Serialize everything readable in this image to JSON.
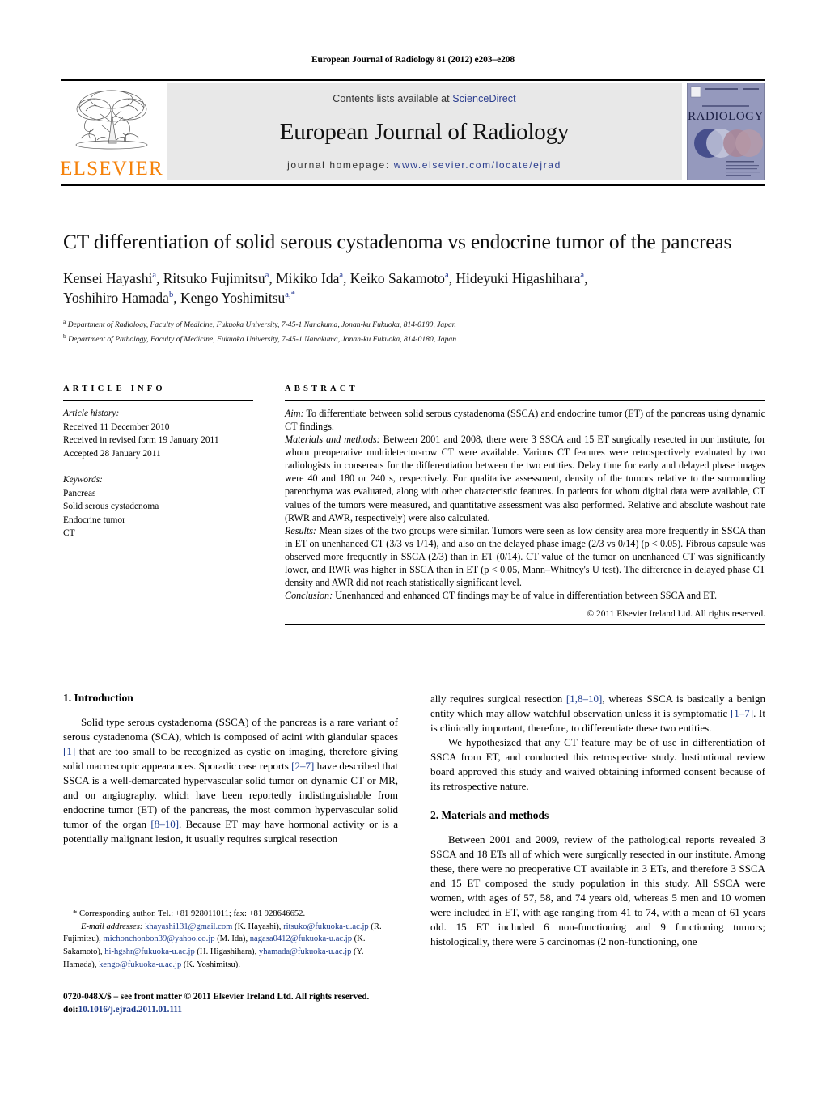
{
  "running_head": "European Journal of Radiology 81 (2012) e203–e208",
  "masthead": {
    "contents_prefix": "Contents lists available at ",
    "contents_link": "ScienceDirect",
    "journal_name": "European Journal of Radiology",
    "homepage_prefix": "journal homepage: ",
    "homepage_url": "www.elsevier.com/locate/ejrad",
    "publisher_logo_text": "ELSEVIER",
    "cover_title": "RADIOLOGY",
    "cover_supertitle": "EUROPEAN JOURNAL OF"
  },
  "article": {
    "title": "CT differentiation of solid serous cystadenoma vs endocrine tumor of the pancreas",
    "authors_line1": "Kensei Hayashi a, Ritsuko Fujimitsu a, Mikiko Ida a, Keiko Sakamoto a, Hideyuki Higashihara a,",
    "authors_line2": "Yoshihiro Hamada b, Kengo Yoshimitsu a,*",
    "affiliation_a": "Department of Radiology, Faculty of Medicine, Fukuoka University, 7-45-1 Nanakuma, Jonan-ku Fukuoka, 814-0180, Japan",
    "affiliation_b": "Department of Pathology, Faculty of Medicine, Fukuoka University, 7-45-1 Nanakuma, Jonan-ku Fukuoka, 814-0180, Japan"
  },
  "article_info": {
    "heading": "ARTICLE INFO",
    "history_label": "Article history:",
    "history": [
      "Received 11 December 2010",
      "Received in revised form 19 January 2011",
      "Accepted 28 January 2011"
    ],
    "keywords_label": "Keywords:",
    "keywords": [
      "Pancreas",
      "Solid serous cystadenoma",
      "Endocrine tumor",
      "CT"
    ]
  },
  "abstract": {
    "heading": "ABSTRACT",
    "aim_label": "Aim:",
    "aim_text": " To differentiate between solid serous cystadenoma (SSCA) and endocrine tumor (ET) of the pancreas using dynamic CT findings.",
    "methods_label": "Materials and methods:",
    "methods_text": " Between 2001 and 2008, there were 3 SSCA and 15 ET surgically resected in our institute, for whom preoperative multidetector-row CT were available. Various CT features were retrospectively evaluated by two radiologists in consensus for the differentiation between the two entities. Delay time for early and delayed phase images were 40 and 180 or 240 s, respectively. For qualitative assessment, density of the tumors relative to the surrounding parenchyma was evaluated, along with other characteristic features. In patients for whom digital data were available, CT values of the tumors were measured, and quantitative assessment was also performed. Relative and absolute washout rate (RWR and AWR, respectively) were also calculated.",
    "results_label": "Results:",
    "results_text": " Mean sizes of the two groups were similar. Tumors were seen as low density area more frequently in SSCA than in ET on unenhanced CT (3/3 vs 1/14), and also on the delayed phase image (2/3 vs 0/14) (p < 0.05). Fibrous capsule was observed more frequently in SSCA (2/3) than in ET (0/14). CT value of the tumor on unenhanced CT was significantly lower, and RWR was higher in SSCA than in ET (p < 0.05, Mann–Whitney's U test). The difference in delayed phase CT density and AWR did not reach statistically significant level.",
    "conclusion_label": "Conclusion:",
    "conclusion_text": " Unenhanced and enhanced CT findings may be of value in differentiation between SSCA and ET.",
    "copyright": "© 2011 Elsevier Ireland Ltd. All rights reserved."
  },
  "sections": {
    "intro_heading": "1. Introduction",
    "intro_p1_a": "Solid type serous cystadenoma (SSCA) of the pancreas is a rare variant of serous cystadenoma (SCA), which is composed of acini with glandular spaces ",
    "intro_p1_ref1": "[1]",
    "intro_p1_b": " that are too small to be recognized as cystic on imaging, therefore giving solid macroscopic appearances. Sporadic case reports ",
    "intro_p1_ref2": "[2–7]",
    "intro_p1_c": " have described that SSCA is a well-demarcated hypervascular solid tumor on dynamic CT or MR, and on angiography, which have been reportedly indistinguishable from endocrine tumor (ET) of the pancreas, the most common hypervascular solid tumor of the organ ",
    "intro_p1_ref3": "[8–10]",
    "intro_p1_d": ". Because ET may have hormonal activity or is a potentially malignant lesion, it usually requires surgical resection ",
    "intro_p1_ref4": "[1,8–10]",
    "intro_p1_e": ", whereas SSCA is basically a benign entity which may allow watchful observation unless it is symptomatic ",
    "intro_p1_ref5": "[1–7]",
    "intro_p1_f": ". It is clinically important, therefore, to differentiate these two entities.",
    "intro_p2": "We hypothesized that any CT feature may be of use in differentiation of SSCA from ET, and conducted this retrospective study. Institutional review board approved this study and waived obtaining informed consent because of its retrospective nature.",
    "methods_heading": "2. Materials and methods",
    "methods_p1": "Between 2001 and 2009, review of the pathological reports revealed 3 SSCA and 18 ETs all of which were surgically resected in our institute. Among these, there were no preoperative CT available in 3 ETs, and therefore 3 SSCA and 15 ET composed the study population in this study. All SSCA were women, with ages of 57, 58, and 74 years old, whereas 5 men and 10 women were included in ET, with age ranging from 41 to 74, with a mean of 61 years old. 15 ET included 6 non-functioning and 9 functioning tumors; histologically, there were 5 carcinomas (2 non-functioning, one"
  },
  "footnotes": {
    "corresponding": "* Corresponding author. Tel.: +81 928011011; fax: +81 928646652.",
    "email_label": "E-mail addresses:",
    "emails": [
      {
        "mail": "khayashi131@gmail.com",
        "name": " (K. Hayashi), "
      },
      {
        "mail": "ritsuko@fukuoka-u.ac.jp",
        "name": " (R. Fujimitsu), "
      },
      {
        "mail": "michonchonbon39@yahoo.co.jp",
        "name": " (M. Ida), "
      },
      {
        "mail": "nagasa0412@fukuoka-u.ac.jp",
        "name": " (K. Sakamoto), "
      },
      {
        "mail": "hi-hgshr@fukuoka-u.ac.jp",
        "name": " (H. Higashihara), "
      },
      {
        "mail": "yhamada@fukuoka-u.ac.jp",
        "name": " (Y. Hamada), "
      },
      {
        "mail": "kengo@fukuoka-u.ac.jp",
        "name": " (K. Yoshimitsu)."
      }
    ],
    "imprint_line1": "0720-048X/$ – see front matter © 2011 Elsevier Ireland Ltd. All rights reserved.",
    "imprint_doi_label": "doi:",
    "imprint_doi": "10.1016/j.ejrad.2011.01.111"
  }
}
